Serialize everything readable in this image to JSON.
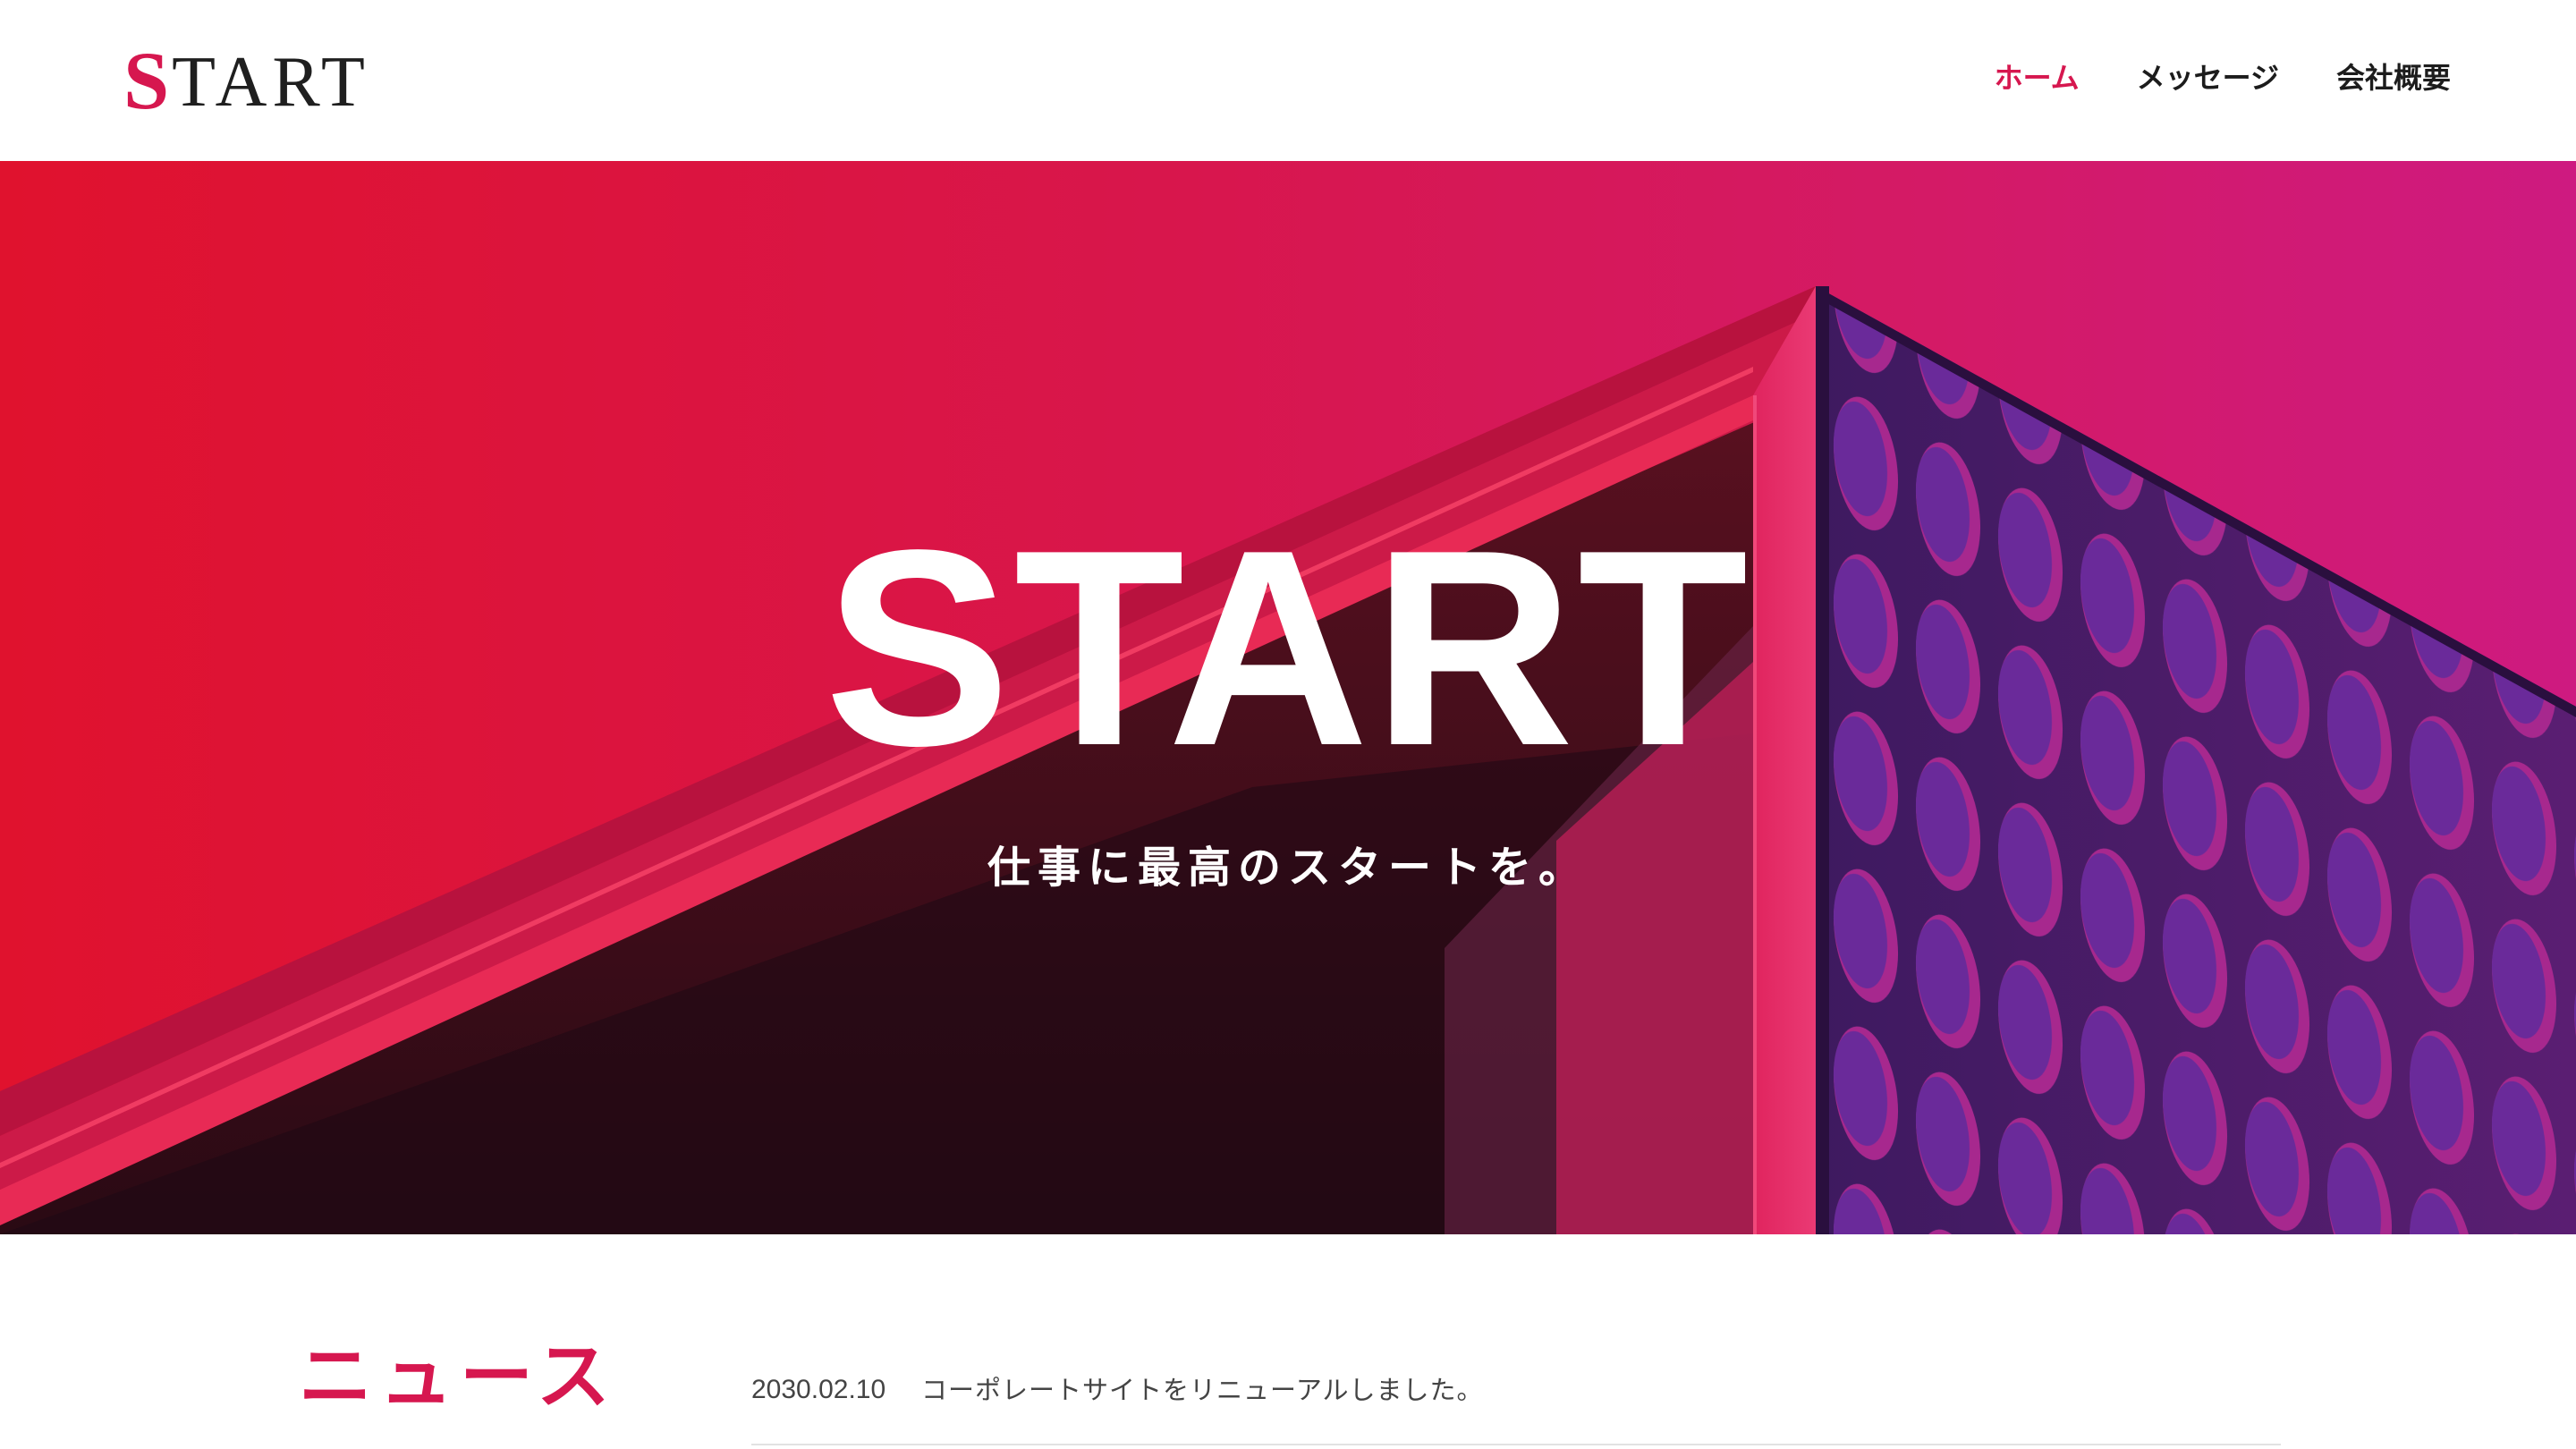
{
  "header": {
    "logo_first": "S",
    "logo_rest": "TART",
    "nav": [
      {
        "label": "ホーム",
        "active": true
      },
      {
        "label": "メッセージ",
        "active": false
      },
      {
        "label": "会社概要",
        "active": false
      }
    ]
  },
  "hero": {
    "title": "START",
    "subtitle": "仕事に最高のスタートを。"
  },
  "news": {
    "heading": "ニュース",
    "items": [
      {
        "date": "2030.02.10",
        "text": "コーポレートサイトをリニューアルしました。"
      }
    ]
  },
  "colors": {
    "accent": "#d6174f",
    "text": "#1f1f1f"
  }
}
